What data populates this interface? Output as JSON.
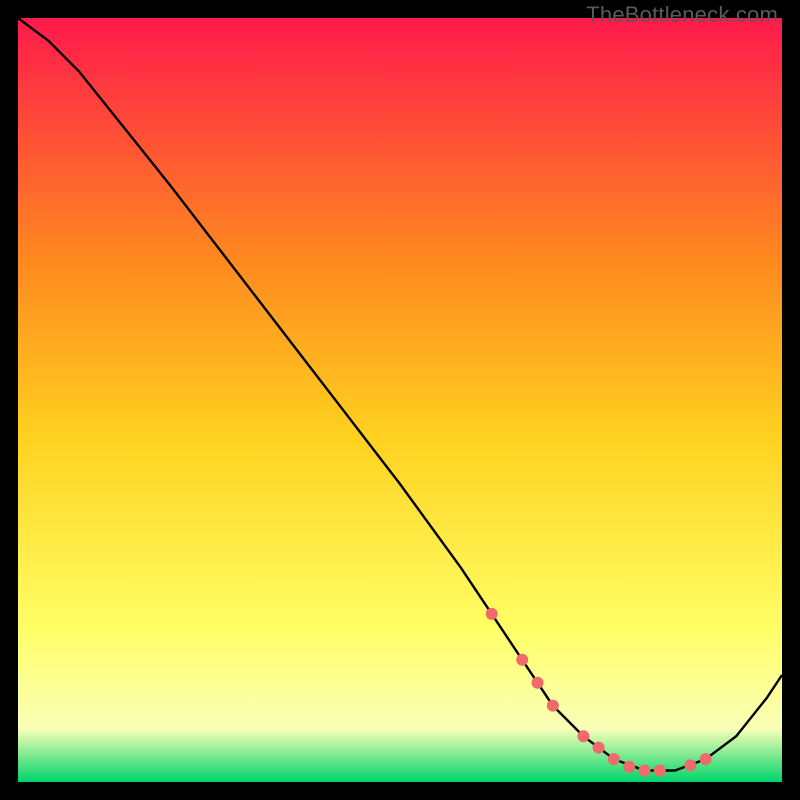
{
  "watermark": "TheBottleneck.com",
  "colors": {
    "gradient_top": "#ff1a4b",
    "gradient_mid_upper": "#ff8a1f",
    "gradient_mid": "#ffd21f",
    "gradient_mid_lower": "#ffff66",
    "gradient_low": "#faffb8",
    "gradient_bottom": "#00d46a",
    "line": "#000000",
    "marker": "#ef6b6b",
    "frame_bg": "#000000"
  },
  "chart_data": {
    "type": "line",
    "title": "",
    "xlabel": "",
    "ylabel": "",
    "xlim": [
      0,
      100
    ],
    "ylim": [
      0,
      100
    ],
    "series": [
      {
        "name": "curve",
        "x": [
          0,
          4,
          8,
          12,
          20,
          30,
          40,
          50,
          58,
          62,
          66,
          70,
          74,
          78,
          82,
          86,
          90,
          94,
          98,
          100
        ],
        "y": [
          100,
          97,
          93,
          88,
          78,
          65,
          52,
          39,
          28,
          22,
          16,
          10,
          6,
          3,
          1.5,
          1.5,
          3,
          6,
          11,
          14
        ]
      }
    ],
    "markers": {
      "name": "highlight-points",
      "x": [
        62,
        66,
        68,
        70,
        74,
        76,
        78,
        80,
        82,
        84,
        88,
        90
      ],
      "y": [
        22,
        16,
        13,
        10,
        6,
        4.5,
        3,
        2,
        1.5,
        1.5,
        2.2,
        3
      ]
    }
  }
}
